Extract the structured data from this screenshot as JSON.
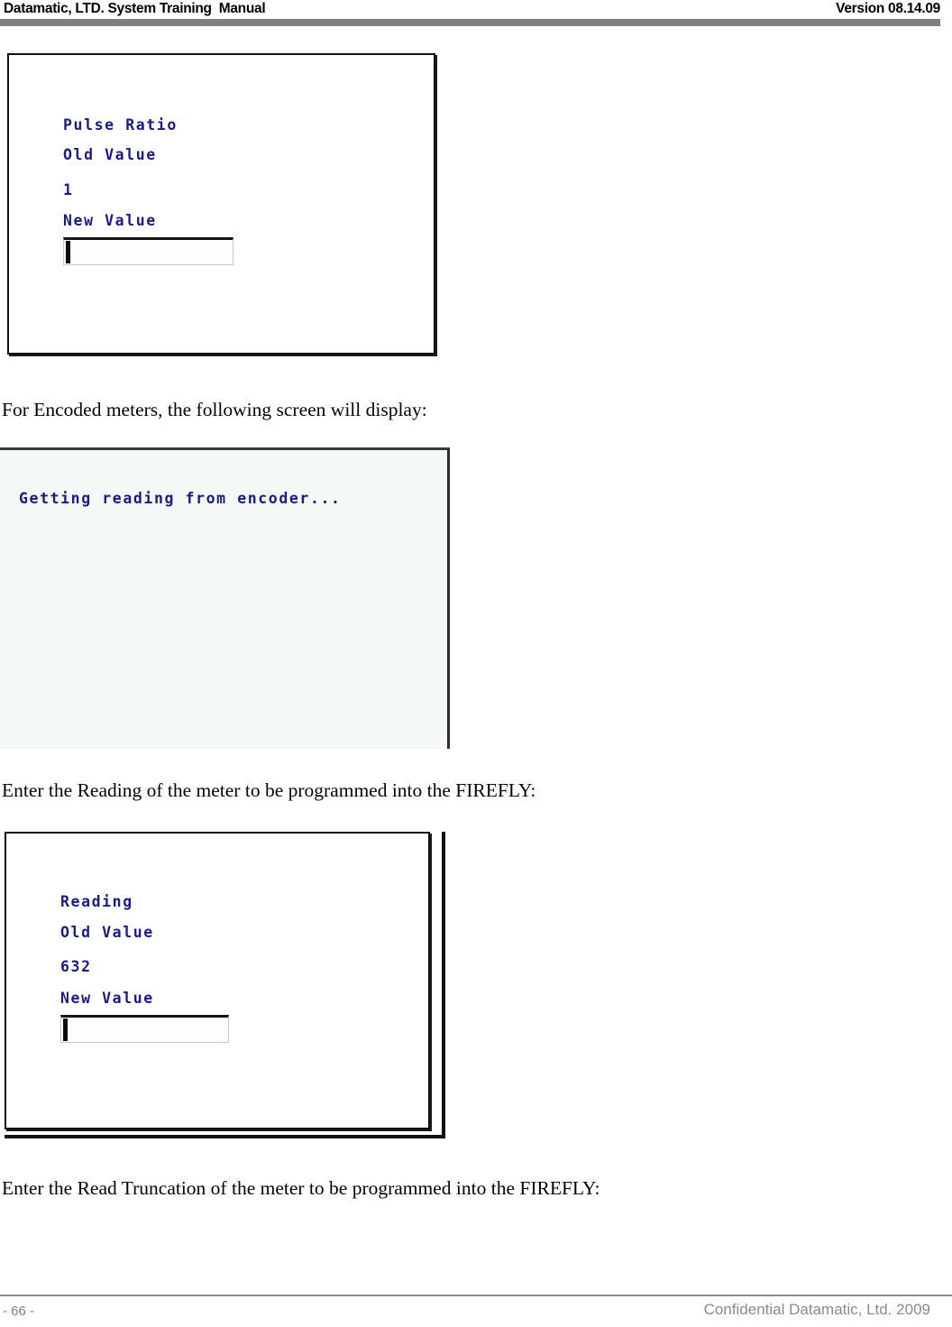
{
  "header": {
    "title": "Datamatic, LTD. System Training  Manual",
    "version": "Version 08.14.09",
    "rule_color": "#808080"
  },
  "screenshots": [
    {
      "name": "pulse-ratio-entry-screen",
      "kind": "handheld-device-screen",
      "background": "#ffffff",
      "text_color": "#1b1b87",
      "lines": [
        "Pulse Ratio",
        "Old Value",
        "1",
        "New Value"
      ],
      "field": {
        "value": "",
        "placeholder": "",
        "has_caret": true
      }
    },
    {
      "name": "encoder-reading-status-screen",
      "kind": "handheld-device-screen",
      "background": "#f4f9f5",
      "text_color": "#1b1b87",
      "lines": [
        "Getting reading from encoder..."
      ]
    },
    {
      "name": "reading-entry-screen",
      "kind": "handheld-device-screen",
      "background": "#ffffff",
      "text_color": "#1b1b87",
      "lines": [
        "Reading",
        "Old Value",
        "632",
        "New Value"
      ],
      "field": {
        "value": "",
        "placeholder": "",
        "has_caret": true
      }
    }
  ],
  "paragraphs": {
    "encoded": "For Encoded meters, the following screen will display:",
    "reading": "Enter the Reading of the meter to be programmed into the FIREFLY:",
    "truncation": "Enter the Read Truncation of the meter to be programmed into the FIREFLY:"
  },
  "footer": {
    "page_number": "- 66 -",
    "confidential": "Confidential Datamatic, Ltd. 2009",
    "rule_color": "#8c8c8c"
  }
}
